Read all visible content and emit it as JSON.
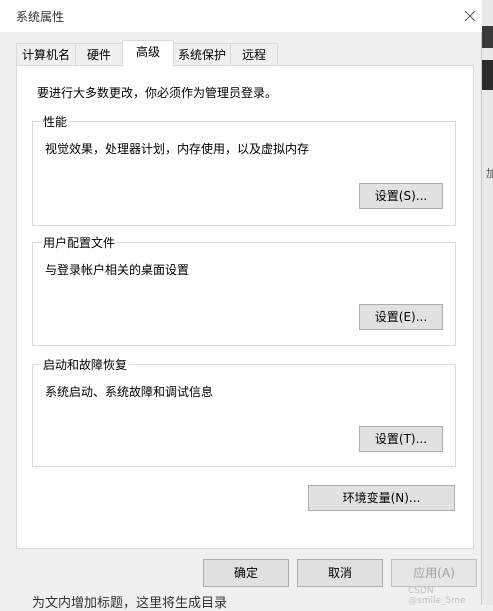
{
  "window": {
    "title": "系统属性"
  },
  "tabs": [
    {
      "label": "计算机名",
      "active": false
    },
    {
      "label": "硬件",
      "active": false
    },
    {
      "label": "高级",
      "active": true
    },
    {
      "label": "系统保护",
      "active": false
    },
    {
      "label": "远程",
      "active": false
    }
  ],
  "admin_note": "要进行大多数更改，你必须作为管理员登录。",
  "groups": {
    "performance": {
      "title": "性能",
      "description": "视觉效果，处理器计划，内存使用，以及虚拟内存",
      "button": "设置(S)..."
    },
    "user_profiles": {
      "title": "用户配置文件",
      "description": "与登录帐户相关的桌面设置",
      "button": "设置(E)..."
    },
    "startup_recovery": {
      "title": "启动和故障恢复",
      "description": "系统启动、系统故障和调试信息",
      "button": "设置(T)..."
    }
  },
  "env_button": "环境变量(N)...",
  "footer": {
    "ok": "确定",
    "cancel": "取消",
    "apply": "应用(A)"
  },
  "background": {
    "behind_text": "为文内增加标题，这里将生成目录",
    "edge_char": "加",
    "watermark": "CSDN @smile_5me"
  },
  "icons": {
    "close": "close-icon"
  }
}
